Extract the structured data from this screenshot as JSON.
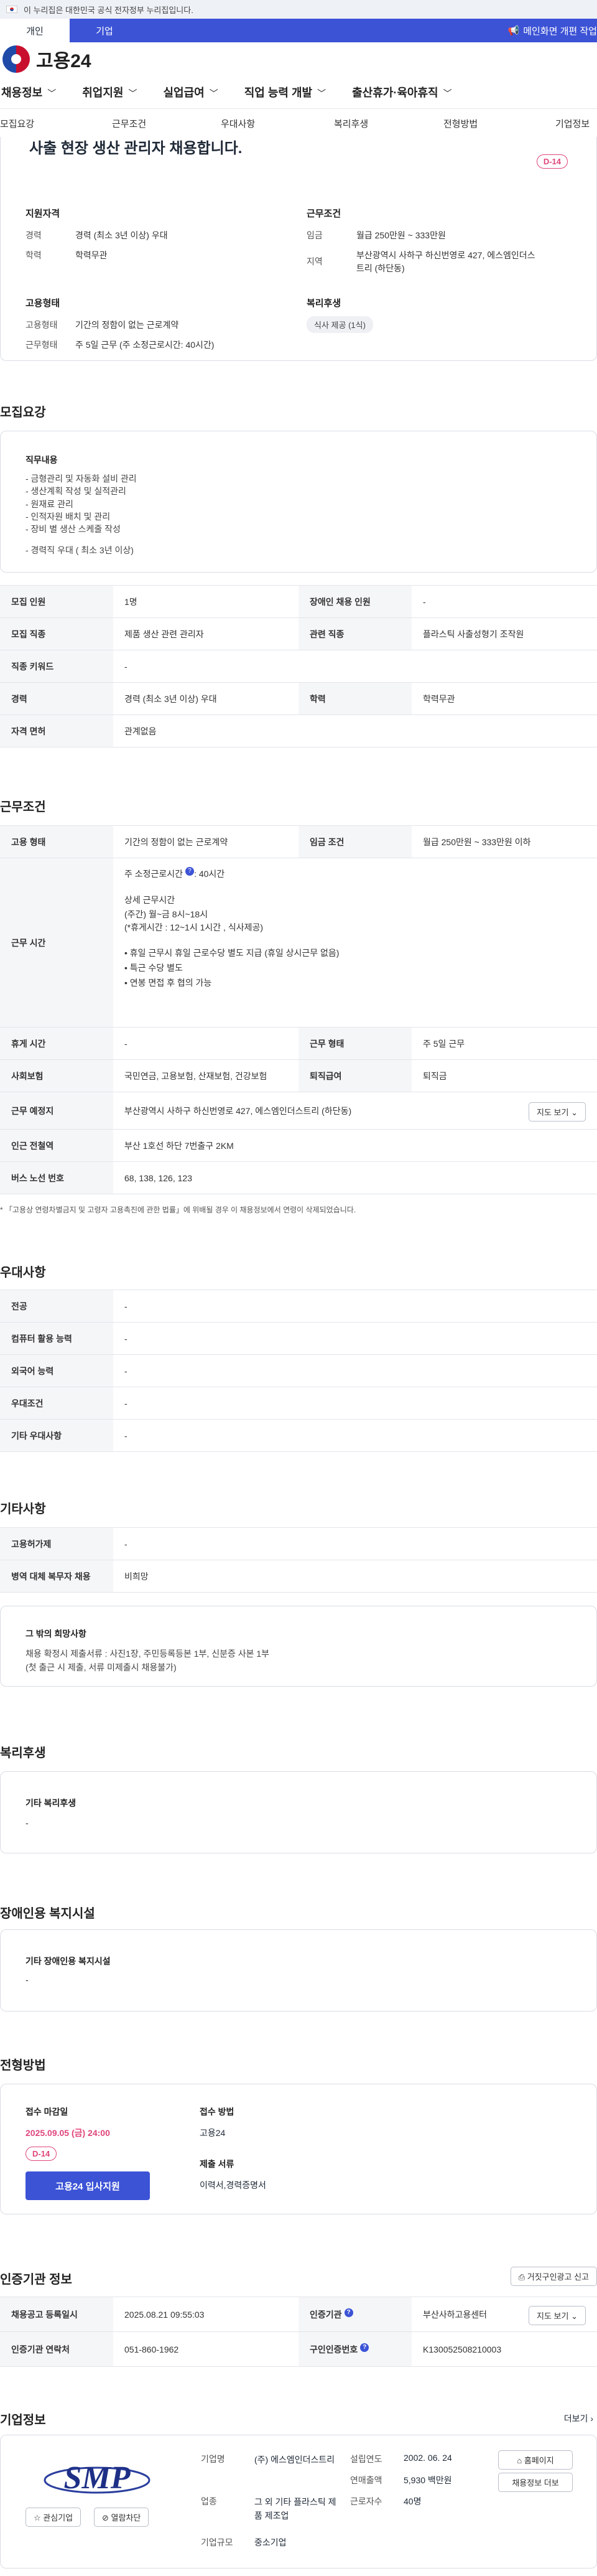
{
  "gov_banner": {
    "text": "이 누리집은 대한민국 공식 전자정부 누리집입니다."
  },
  "tabs": [
    {
      "label": "개인"
    },
    {
      "label": "기업"
    }
  ],
  "notice": {
    "label": "메인화면 개편 작업"
  },
  "brand": {
    "name": "고용24"
  },
  "gnb": [
    {
      "label": "채용정보"
    },
    {
      "label": "취업지원"
    },
    {
      "label": "실업급여"
    },
    {
      "label": "직업 능력 개발"
    },
    {
      "label": "출산휴가·육아휴직"
    }
  ],
  "anchors": [
    {
      "label": "모집요강"
    },
    {
      "label": "근무조건"
    },
    {
      "label": "우대사항"
    },
    {
      "label": "복리후생"
    },
    {
      "label": "전형방법"
    },
    {
      "label": "기업정보"
    }
  ],
  "hero": {
    "title": "사출 현장 생산 관리자 채용합니다.",
    "dday": "D-14",
    "qual_title": "지원자격",
    "qual": [
      {
        "k": "경력",
        "v": "경력 (최소 3년 이상) 우대"
      },
      {
        "k": "학력",
        "v": "학력무관"
      }
    ],
    "cond_title": "근무조건",
    "cond": [
      {
        "k": "임금",
        "v": "월급 250만원 ~ 333만원"
      },
      {
        "k": "지역",
        "v": "부산광역시 사하구 하신번영로 427, 에스엠인더스트리 (하단동)"
      }
    ],
    "emp_title": "고용형태",
    "emp": [
      {
        "k": "고용형태",
        "v": "기간의 정함이 없는 근로계약"
      },
      {
        "k": "근무형태",
        "v": "주 5일 근무 (주 소정근로시간: 40시간)"
      }
    ],
    "welfare_title": "복리후생",
    "welfare_chip": "식사 제공 (1식)"
  },
  "recruit": {
    "section_title": "모집요강",
    "duty_title": "직무내용",
    "duty_lines": [
      "- 금형관리 및 자동화 설비 관리",
      "- 생산계획 작성 및 실적관리",
      "- 원재료 관리",
      "- 인적자원 배치 및 관리",
      "- 장비 별 생산 스케줄 작성",
      "",
      "- 경력직 우대 ( 최소 3년 이상)"
    ],
    "rows": [
      {
        "h1": "모집 인원",
        "v1": "1명",
        "h2": "장애인 채용 인원",
        "v2": "-"
      },
      {
        "h1": "모집 직종",
        "v1": "제품 생산 관련 관리자",
        "h2": "관련 직종",
        "v2": "플라스틱 사출성형기 조작원"
      },
      {
        "h1": "직종 키워드",
        "v1": "-",
        "h2": "",
        "v2": ""
      },
      {
        "h1": "경력",
        "v1": "경력 (최소 3년 이상) 우대",
        "h2": "학력",
        "v2": "학력무관"
      },
      {
        "h1": "자격 면허",
        "v1": "관계없음",
        "h2": "",
        "v2": ""
      }
    ]
  },
  "work": {
    "section_title": "근무조건",
    "emp_h": "고용 형태",
    "emp_v": "기간의 정함이 없는 근로계약",
    "wage_h": "임금 조건",
    "wage_v": "월급 250만원 ~ 333만원 이하",
    "time_h": "근무 시간",
    "time_main": "주 소정근로시간",
    "time_hours": ": 40시간",
    "time_detail_title": "상세 근무시간",
    "time_detail": "(주간) 월~금 8시~18시\n(*휴게시간 : 12~1시 1시간 ,  식사제공)",
    "time_bullets": [
      "• 휴일 근무시 휴일 근로수당 별도 지급 (휴일 상시근무 없음)",
      "• 특근 수당 별도",
      "• 연봉 면접 후 협의 가능"
    ],
    "rest_h": "휴게 시간",
    "rest_v": "-",
    "form_h": "근무 형태",
    "form_v": "주 5일 근무",
    "ins_h": "사회보험",
    "ins_v": "국민연금, 고용보험, 산재보험, 건강보험",
    "ret_h": "퇴직급여",
    "ret_v": "퇴직금",
    "place_h": "근무 예정지",
    "place_v": "부산광역시 사하구 하신번영로 427, 에스엠인더스트리 (하단동)",
    "map_btn": "지도 보기",
    "sub_h": "인근 전철역",
    "sub_v": "부산 1호선 하단 7번출구 2KM",
    "bus_h": "버스 노선 번호",
    "bus_v": "68, 138, 126, 123",
    "note": "* 「고용상 연령차별금지 및 고령자 고용촉진에 관한 법률」에 위배될 경우 이 채용정보에서 연령이 삭제되었습니다."
  },
  "pref": {
    "section_title": "우대사항",
    "rows": [
      {
        "h": "전공",
        "v": "-"
      },
      {
        "h": "컴퓨터 활용 능력",
        "v": "-"
      },
      {
        "h": "외국어 능력",
        "v": "-"
      },
      {
        "h": "우대조건",
        "v": "-"
      },
      {
        "h": "기타 우대사항",
        "v": "-"
      }
    ]
  },
  "other": {
    "section_title": "기타사항",
    "rows": [
      {
        "h": "고용허가제",
        "v": "-"
      },
      {
        "h": "병역 대체 복무자 채용",
        "v": "비희망"
      }
    ],
    "extra_title": "그 밖의 희망사항",
    "extra_text": "채용 확정시 제출서류 : 사진1장, 주민등록등본 1부, 신분증 사본 1부\n(첫 출근 시 제출, 서류 미제출시 채용불가)"
  },
  "welfare": {
    "section_title": "복리후생",
    "title": "기타 복리후생",
    "value": "-"
  },
  "disabled": {
    "section_title": "장애인용 복지시설",
    "title": "기타 장애인용 복지시설",
    "value": "-"
  },
  "process": {
    "section_title": "전형방법",
    "deadline_title": "접수 마감일",
    "deadline": "2025.09.05 (금) 24:00",
    "dday": "D-14",
    "apply_btn": "고용24 입사지원",
    "method_title": "접수 방법",
    "method": "고용24",
    "docs_title": "제출 서류",
    "docs": "이력서,경력증명서"
  },
  "cert": {
    "section_title": "인증기관 정보",
    "report_btn": "거짓구인광고 신고",
    "reg_h": "채용공고 등록일시",
    "reg_v": "2025.08.21 09:55:03",
    "org_h": "인증기관",
    "org_v": "부산사하고용센터",
    "map_btn": "지도 보기",
    "tel_h": "인증기관 연락처",
    "tel_v": "051-860-1962",
    "id_h": "구인인증번호",
    "id_v": "K130052508210003"
  },
  "company": {
    "section_title": "기업정보",
    "more": "더보기",
    "logo_text": "SMP",
    "fav_btn": "관심기업",
    "block_btn": "열람차단",
    "name_k": "기업명",
    "name_v": "(주) 에스엠인더스트리",
    "ind_k": "업종",
    "ind_v": "그 외 기타 플라스틱 제품 제조업",
    "size_k": "기업규모",
    "size_v": "중소기업",
    "est_k": "설립연도",
    "est_v": "2002. 06. 24",
    "sales_k": "연매출액",
    "sales_v": "5,930 백만원",
    "emp_k": "근로자수",
    "emp_v": "40명",
    "home_btn": "홈페이지",
    "list_btn": "채용정보 더보"
  },
  "colors": {
    "primary": "#3c53d6",
    "dday": "#e0457b"
  }
}
